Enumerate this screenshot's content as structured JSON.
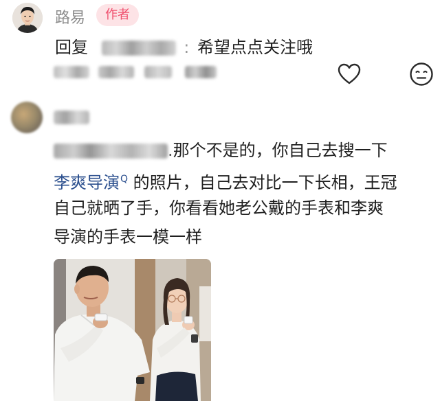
{
  "comment1": {
    "username": "路易",
    "badge": "作者",
    "reply_prefix": "回复",
    "reply_text": "希望点点关注哦"
  },
  "comment2": {
    "text_part1": "那个不是的，你自己去搜一下",
    "link_text": "李爽导演",
    "search_mark": "Q",
    "text_line2_rest": " 的照片，自己去对比一下长相，王冠",
    "text_line3": "自己就晒了手，你看看她老公戴的手表和李爽",
    "text_line4": "导演的手表一模一样"
  },
  "icons": {
    "like": "heart-icon",
    "emoji": "emoji-icon",
    "search": "search-icon"
  },
  "colors": {
    "badge_bg": "#fde3e6",
    "badge_text": "#f0506e",
    "link": "#2b4f8e",
    "meta": "#8c8c8c"
  }
}
